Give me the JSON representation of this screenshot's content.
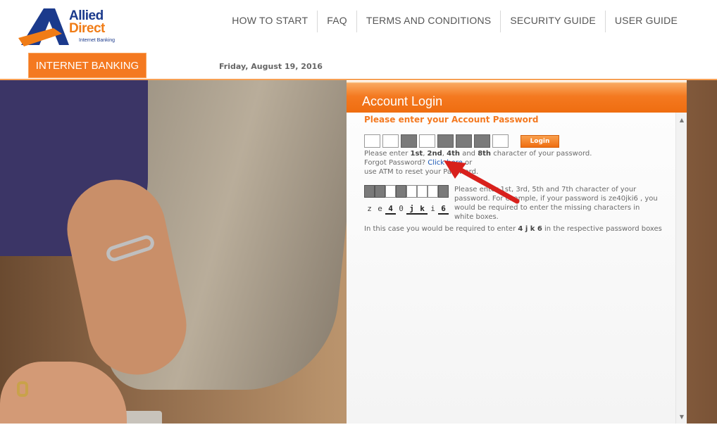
{
  "header": {
    "logo": {
      "line1": "Allied",
      "line2": "Direct",
      "tagline": "Internet Banking"
    },
    "nav": [
      "HOW TO START",
      "FAQ",
      "TERMS AND CONDITIONS",
      "SECURITY GUIDE",
      "USER GUIDE"
    ],
    "tab_label": "INTERNET BANKING",
    "date": "Friday, August 19, 2016"
  },
  "colors": {
    "accent": "#f47920",
    "link": "#1a57b6",
    "brand_blue": "#1b3a8c"
  },
  "login": {
    "title": "Account Login",
    "heading": "Please enter your Account Password",
    "password_boxes": [
      {
        "state": "empty"
      },
      {
        "state": "empty"
      },
      {
        "state": "filled"
      },
      {
        "state": "empty"
      },
      {
        "state": "filled"
      },
      {
        "state": "filled"
      },
      {
        "state": "filled"
      },
      {
        "state": "empty"
      }
    ],
    "button_label": "Login",
    "instruction": {
      "prefix": "Please enter ",
      "p1": "1st",
      "sep1": ", ",
      "p2": "2nd",
      "sep2": ", ",
      "p3": "4th",
      "sep3": " and ",
      "p4": "8th",
      "suffix": " character of your password."
    },
    "forgot_prefix": "Forgot Password? ",
    "forgot_link": "Click here",
    "forgot_suffix": " or",
    "atm_text": "use ATM to reset your Password.",
    "example": {
      "boxes": [
        "filled",
        "filled",
        "empty",
        "filled",
        "empty",
        "empty",
        "empty",
        "filled"
      ],
      "chars": [
        "z",
        "e",
        "4",
        "0",
        "j",
        "k",
        "i",
        "6"
      ],
      "highlight": [
        false,
        false,
        true,
        false,
        true,
        true,
        false,
        true
      ],
      "description": "Please enter 1st, 3rd, 5th and 7th character of your password. For example, if your password is ze40jki6 , you would be required to enter the missing characters in white boxes.",
      "footer_prefix": "In this case you would be required to enter ",
      "footer_bold": "4 j k 6",
      "footer_suffix": " in the respective password boxes"
    }
  }
}
